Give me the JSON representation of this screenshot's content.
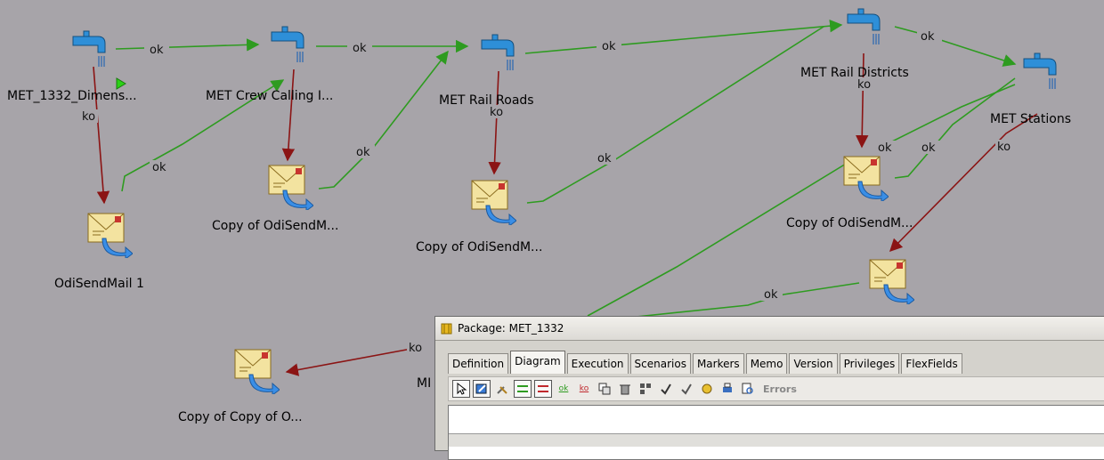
{
  "nodes": {
    "met_1332": "MET_1332_Dimens...",
    "crew": "MET Crew Calling I...",
    "rail_roads": "MET Rail Roads",
    "rail_districts": "MET Rail Districts",
    "stations": "MET Stations",
    "mail1": "OdiSendMail 1",
    "copy1": "Copy of OdiSendM...",
    "copy2": "Copy of OdiSendM...",
    "copy3": "Copy of OdiSendM...",
    "copycopy": "Copy of Copy of O...",
    "partial": "MI"
  },
  "links": {
    "ok": "ok",
    "ko": "ko"
  },
  "window": {
    "title": "Package: MET_1332",
    "tabs": [
      "Definition",
      "Diagram",
      "Execution",
      "Scenarios",
      "Markers",
      "Memo",
      "Version",
      "Privileges",
      "FlexFields"
    ],
    "active_tab": "Diagram",
    "toolbar": {
      "ok_label": "ok",
      "ko_label": "ko",
      "errors_label": "Errors"
    }
  },
  "colors": {
    "ok_link": "#2e9b20",
    "ko_link": "#8b1414",
    "canvas": "#a7a4a9"
  }
}
